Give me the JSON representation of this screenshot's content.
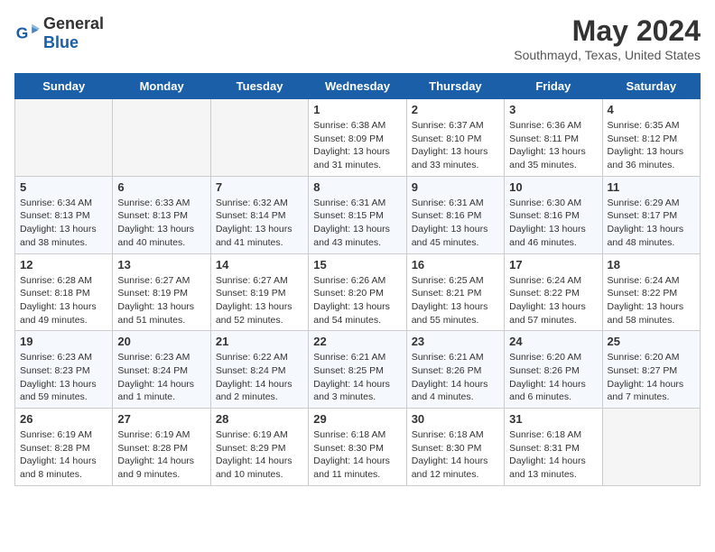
{
  "logo": {
    "general": "General",
    "blue": "Blue"
  },
  "header": {
    "month": "May 2024",
    "location": "Southmayd, Texas, United States"
  },
  "weekdays": [
    "Sunday",
    "Monday",
    "Tuesday",
    "Wednesday",
    "Thursday",
    "Friday",
    "Saturday"
  ],
  "weeks": [
    [
      {
        "day": "",
        "info": ""
      },
      {
        "day": "",
        "info": ""
      },
      {
        "day": "",
        "info": ""
      },
      {
        "day": "1",
        "info": "Sunrise: 6:38 AM\nSunset: 8:09 PM\nDaylight: 13 hours and 31 minutes."
      },
      {
        "day": "2",
        "info": "Sunrise: 6:37 AM\nSunset: 8:10 PM\nDaylight: 13 hours and 33 minutes."
      },
      {
        "day": "3",
        "info": "Sunrise: 6:36 AM\nSunset: 8:11 PM\nDaylight: 13 hours and 35 minutes."
      },
      {
        "day": "4",
        "info": "Sunrise: 6:35 AM\nSunset: 8:12 PM\nDaylight: 13 hours and 36 minutes."
      }
    ],
    [
      {
        "day": "5",
        "info": "Sunrise: 6:34 AM\nSunset: 8:13 PM\nDaylight: 13 hours and 38 minutes."
      },
      {
        "day": "6",
        "info": "Sunrise: 6:33 AM\nSunset: 8:13 PM\nDaylight: 13 hours and 40 minutes."
      },
      {
        "day": "7",
        "info": "Sunrise: 6:32 AM\nSunset: 8:14 PM\nDaylight: 13 hours and 41 minutes."
      },
      {
        "day": "8",
        "info": "Sunrise: 6:31 AM\nSunset: 8:15 PM\nDaylight: 13 hours and 43 minutes."
      },
      {
        "day": "9",
        "info": "Sunrise: 6:31 AM\nSunset: 8:16 PM\nDaylight: 13 hours and 45 minutes."
      },
      {
        "day": "10",
        "info": "Sunrise: 6:30 AM\nSunset: 8:16 PM\nDaylight: 13 hours and 46 minutes."
      },
      {
        "day": "11",
        "info": "Sunrise: 6:29 AM\nSunset: 8:17 PM\nDaylight: 13 hours and 48 minutes."
      }
    ],
    [
      {
        "day": "12",
        "info": "Sunrise: 6:28 AM\nSunset: 8:18 PM\nDaylight: 13 hours and 49 minutes."
      },
      {
        "day": "13",
        "info": "Sunrise: 6:27 AM\nSunset: 8:19 PM\nDaylight: 13 hours and 51 minutes."
      },
      {
        "day": "14",
        "info": "Sunrise: 6:27 AM\nSunset: 8:19 PM\nDaylight: 13 hours and 52 minutes."
      },
      {
        "day": "15",
        "info": "Sunrise: 6:26 AM\nSunset: 8:20 PM\nDaylight: 13 hours and 54 minutes."
      },
      {
        "day": "16",
        "info": "Sunrise: 6:25 AM\nSunset: 8:21 PM\nDaylight: 13 hours and 55 minutes."
      },
      {
        "day": "17",
        "info": "Sunrise: 6:24 AM\nSunset: 8:22 PM\nDaylight: 13 hours and 57 minutes."
      },
      {
        "day": "18",
        "info": "Sunrise: 6:24 AM\nSunset: 8:22 PM\nDaylight: 13 hours and 58 minutes."
      }
    ],
    [
      {
        "day": "19",
        "info": "Sunrise: 6:23 AM\nSunset: 8:23 PM\nDaylight: 13 hours and 59 minutes."
      },
      {
        "day": "20",
        "info": "Sunrise: 6:23 AM\nSunset: 8:24 PM\nDaylight: 14 hours and 1 minute."
      },
      {
        "day": "21",
        "info": "Sunrise: 6:22 AM\nSunset: 8:24 PM\nDaylight: 14 hours and 2 minutes."
      },
      {
        "day": "22",
        "info": "Sunrise: 6:21 AM\nSunset: 8:25 PM\nDaylight: 14 hours and 3 minutes."
      },
      {
        "day": "23",
        "info": "Sunrise: 6:21 AM\nSunset: 8:26 PM\nDaylight: 14 hours and 4 minutes."
      },
      {
        "day": "24",
        "info": "Sunrise: 6:20 AM\nSunset: 8:26 PM\nDaylight: 14 hours and 6 minutes."
      },
      {
        "day": "25",
        "info": "Sunrise: 6:20 AM\nSunset: 8:27 PM\nDaylight: 14 hours and 7 minutes."
      }
    ],
    [
      {
        "day": "26",
        "info": "Sunrise: 6:19 AM\nSunset: 8:28 PM\nDaylight: 14 hours and 8 minutes."
      },
      {
        "day": "27",
        "info": "Sunrise: 6:19 AM\nSunset: 8:28 PM\nDaylight: 14 hours and 9 minutes."
      },
      {
        "day": "28",
        "info": "Sunrise: 6:19 AM\nSunset: 8:29 PM\nDaylight: 14 hours and 10 minutes."
      },
      {
        "day": "29",
        "info": "Sunrise: 6:18 AM\nSunset: 8:30 PM\nDaylight: 14 hours and 11 minutes."
      },
      {
        "day": "30",
        "info": "Sunrise: 6:18 AM\nSunset: 8:30 PM\nDaylight: 14 hours and 12 minutes."
      },
      {
        "day": "31",
        "info": "Sunrise: 6:18 AM\nSunset: 8:31 PM\nDaylight: 14 hours and 13 minutes."
      },
      {
        "day": "",
        "info": ""
      }
    ]
  ]
}
